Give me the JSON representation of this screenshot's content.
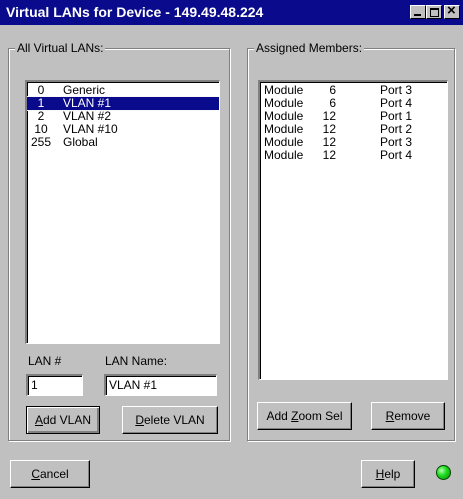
{
  "window": {
    "title": "Virtual LANs for Device - 149.49.48.224"
  },
  "all_vlans": {
    "label": "All Virtual LANs:",
    "items": [
      {
        "num": "0",
        "name": "Generic",
        "selected": false
      },
      {
        "num": "1",
        "name": "VLAN #1",
        "selected": true
      },
      {
        "num": "2",
        "name": "VLAN #2",
        "selected": false
      },
      {
        "num": "10",
        "name": "VLAN #10",
        "selected": false
      },
      {
        "num": "255",
        "name": "Global",
        "selected": false
      }
    ],
    "lan_num_label": "LAN #",
    "lan_num_value": "1",
    "lan_name_label": "LAN Name:",
    "lan_name_value": "VLAN #1",
    "add_button": {
      "pre": "",
      "ul": "A",
      "post": "dd VLAN"
    },
    "delete_button": {
      "pre": "",
      "ul": "D",
      "post": "elete VLAN"
    }
  },
  "assigned_members": {
    "label": "Assigned Members:",
    "items": [
      {
        "module": "Module",
        "module_num": "6",
        "port": "Port 3"
      },
      {
        "module": "Module",
        "module_num": "6",
        "port": "Port 4"
      },
      {
        "module": "Module",
        "module_num": "12",
        "port": "Port 1"
      },
      {
        "module": "Module",
        "module_num": "12",
        "port": "Port 2"
      },
      {
        "module": "Module",
        "module_num": "12",
        "port": "Port 3"
      },
      {
        "module": "Module",
        "module_num": "12",
        "port": "Port 4"
      }
    ],
    "add_zoom_button": {
      "pre": "Add ",
      "ul": "Z",
      "post": "oom Sel"
    },
    "remove_button": {
      "pre": "",
      "ul": "R",
      "post": "emove"
    }
  },
  "footer": {
    "cancel_button": {
      "pre": "",
      "ul": "C",
      "post": "ancel"
    },
    "help_button": {
      "pre": "",
      "ul": "H",
      "post": "elp"
    },
    "status_color": "#22dd22"
  },
  "icons": {
    "minimize": "minimize-icon",
    "maximize": "maximize-icon",
    "close": "close-icon",
    "status": "status-led-icon"
  }
}
